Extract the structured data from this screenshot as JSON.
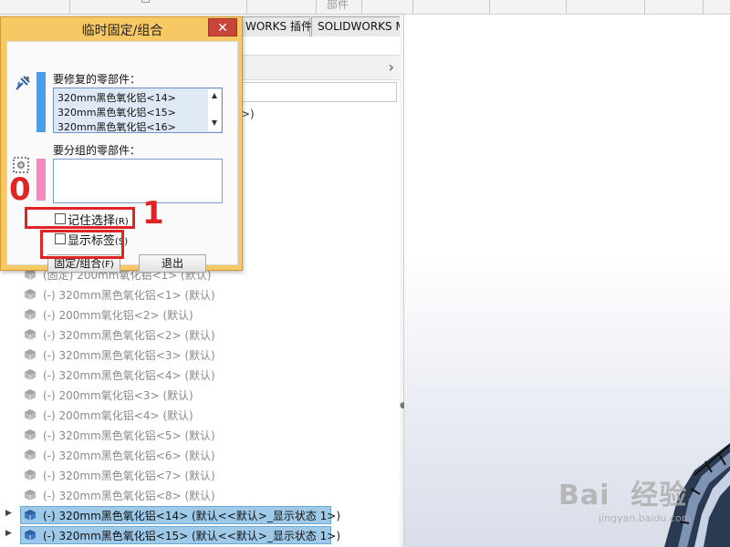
{
  "ribbon": {
    "fragment_text": "部件"
  },
  "tabs": [
    {
      "label": "WORKS 插件"
    },
    {
      "label": "SOLIDWORKS MBD"
    }
  ],
  "panel": {
    "tree_fragment": ">)",
    "chevron": "›"
  },
  "tree": {
    "rows": [
      {
        "text": "(固定) 200mm氧化铝<1> (默认)",
        "selected": false
      },
      {
        "text": "(-) 320mm黑色氧化铝<1> (默认)",
        "selected": false
      },
      {
        "text": "(-) 200mm氧化铝<2> (默认)",
        "selected": false
      },
      {
        "text": "(-) 320mm黑色氧化铝<2> (默认)",
        "selected": false
      },
      {
        "text": "(-) 320mm黑色氧化铝<3> (默认)",
        "selected": false
      },
      {
        "text": "(-) 320mm黑色氧化铝<4> (默认)",
        "selected": false
      },
      {
        "text": "(-) 200mm氧化铝<3> (默认)",
        "selected": false
      },
      {
        "text": "(-) 200mm氧化铝<4> (默认)",
        "selected": false
      },
      {
        "text": "(-) 320mm黑色氧化铝<5> (默认)",
        "selected": false
      },
      {
        "text": "(-) 320mm黑色氧化铝<6> (默认)",
        "selected": false
      },
      {
        "text": "(-) 320mm黑色氧化铝<7> (默认)",
        "selected": false
      },
      {
        "text": "(-) 320mm黑色氧化铝<8> (默认)",
        "selected": false
      },
      {
        "text": "(-) 320mm黑色氧化铝<14> (默认<<默认>_显示状态 1>)",
        "selected": true
      },
      {
        "text": "(-) 320mm黑色氧化铝<15> (默认<<默认>_显示状态 1>)",
        "selected": true
      }
    ],
    "expander_glyph": "▶"
  },
  "dialog": {
    "title": "临时固定/组合",
    "close_glyph": "✕",
    "repair_label": "要修复的零部件：",
    "repair_items": [
      "320mm黑色氧化铝<14>",
      "320mm黑色氧化铝<15>",
      "320mm黑色氧化铝<16>"
    ],
    "group_label": "要分组的零部件：",
    "remember_label": "记住选择",
    "remember_hotkey": "(R)",
    "show_labels_label": "显示标签",
    "show_labels_hotkey": "(S)",
    "fix_group_button": "固定/组合",
    "fix_group_hotkey": "(F)",
    "exit_button": "退出",
    "scroll_up": "▲",
    "scroll_down": "▼",
    "colors": {
      "repair_bar": "#4a9fe8",
      "group_bar": "#f08ac0",
      "dialog_bg": "#f6c965"
    }
  },
  "annotations": {
    "label_0": "0",
    "label_1": "1",
    "color": "#e02424"
  },
  "watermark": {
    "brand": "Bai  经验",
    "url": "jingyan.baidu.com"
  }
}
